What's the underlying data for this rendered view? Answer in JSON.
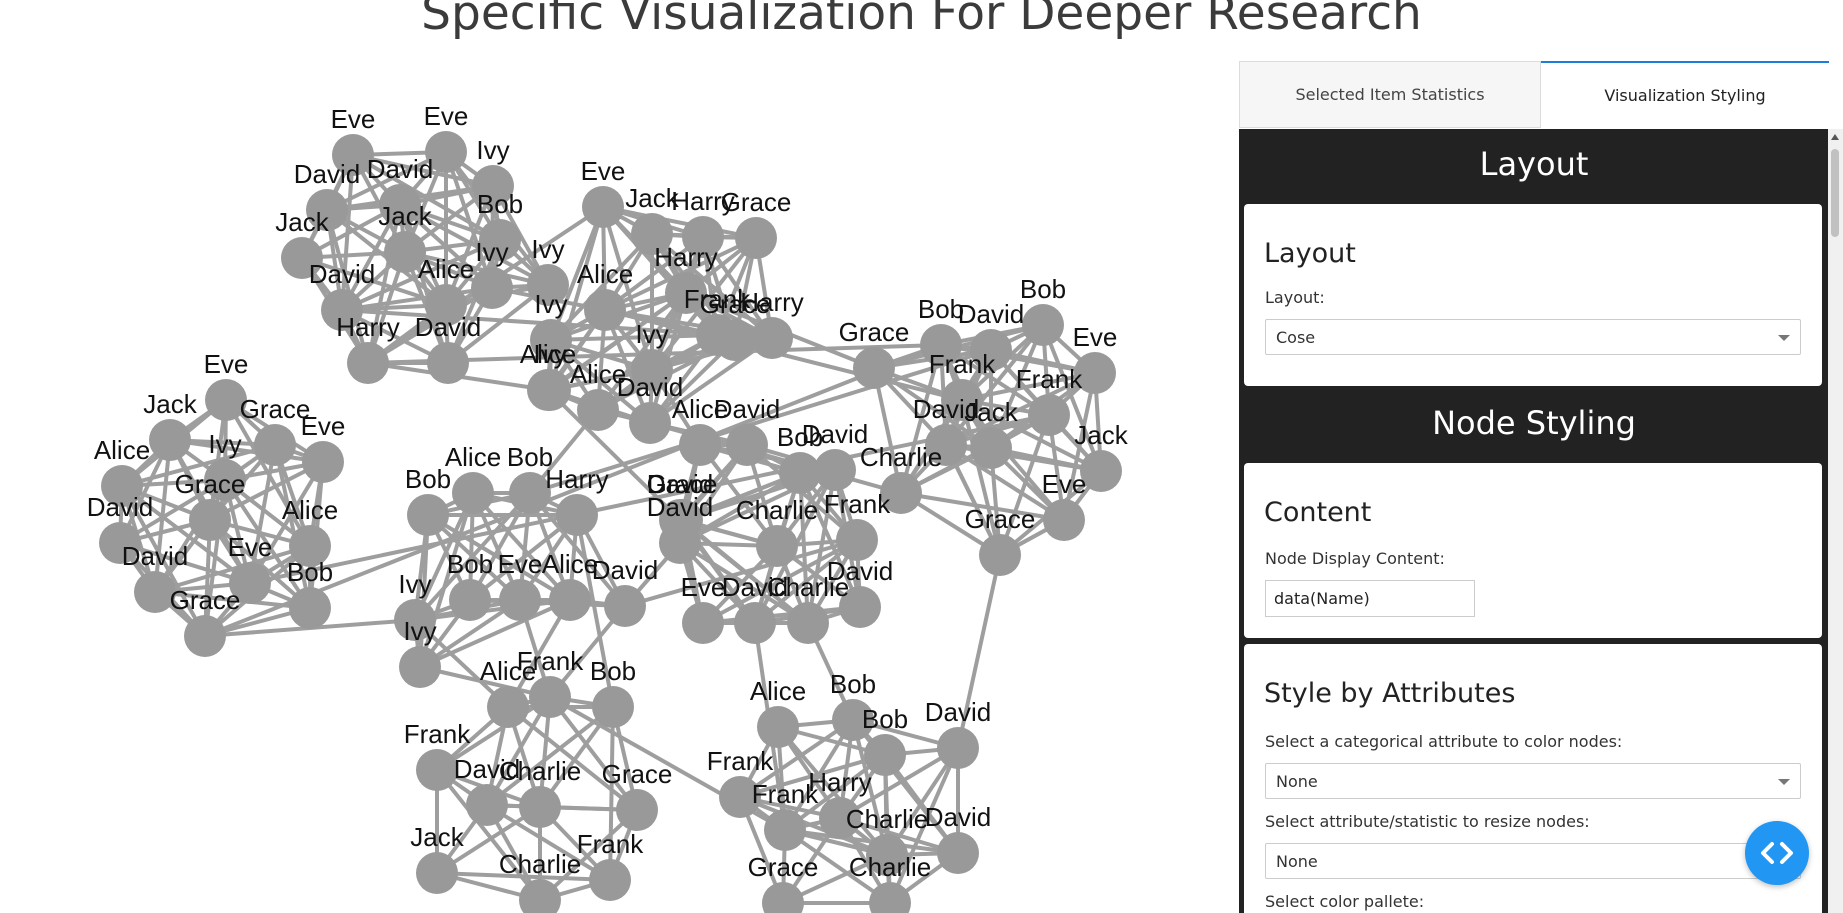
{
  "page": {
    "title": "Specific Visualization For Deeper Research"
  },
  "graph": {
    "node_color": "#999999",
    "edge_color": "#9e9e9e",
    "nodes": [
      {
        "id": "n1",
        "label": "Eve"
      },
      {
        "id": "n2",
        "label": "Eve"
      },
      {
        "id": "n3",
        "label": "Ivy"
      },
      {
        "id": "n4",
        "label": "David"
      },
      {
        "id": "n5",
        "label": "David"
      },
      {
        "id": "n6",
        "label": "Bob"
      },
      {
        "id": "n7",
        "label": "Jack"
      },
      {
        "id": "n8",
        "label": "Jack"
      },
      {
        "id": "n9",
        "label": "Ivy"
      },
      {
        "id": "n10",
        "label": "Ivy"
      },
      {
        "id": "n11",
        "label": "David"
      },
      {
        "id": "n12",
        "label": "Alice"
      },
      {
        "id": "n13",
        "label": "Harry"
      },
      {
        "id": "n14",
        "label": "David"
      },
      {
        "id": "n15",
        "label": "Ivy"
      },
      {
        "id": "n16",
        "label": "Jack"
      },
      {
        "id": "n17",
        "label": "Harry"
      },
      {
        "id": "n18",
        "label": "Grace"
      },
      {
        "id": "n19",
        "label": "Eve"
      },
      {
        "id": "n20",
        "label": "Alice"
      },
      {
        "id": "n21",
        "label": "Harry"
      },
      {
        "id": "n22",
        "label": "Frank"
      },
      {
        "id": "n23",
        "label": "Grace"
      },
      {
        "id": "n24",
        "label": "Harry"
      },
      {
        "id": "n25",
        "label": "Ivy"
      },
      {
        "id": "n26",
        "label": "Ivy"
      },
      {
        "id": "n27",
        "label": "Alice"
      },
      {
        "id": "n28",
        "label": "Alice"
      },
      {
        "id": "n29",
        "label": "David"
      },
      {
        "id": "n30",
        "label": "Bob"
      },
      {
        "id": "n31",
        "label": "David"
      },
      {
        "id": "n32",
        "label": "Bob"
      },
      {
        "id": "n33",
        "label": "Grace"
      },
      {
        "id": "n34",
        "label": "Frank"
      },
      {
        "id": "n35",
        "label": "Eve"
      },
      {
        "id": "n36",
        "label": "Frank"
      },
      {
        "id": "n37",
        "label": "David"
      },
      {
        "id": "n38",
        "label": "Jack"
      },
      {
        "id": "n39",
        "label": "Charlie"
      },
      {
        "id": "n40",
        "label": "Jack"
      },
      {
        "id": "n41",
        "label": "Eve"
      },
      {
        "id": "n42",
        "label": "Grace"
      },
      {
        "id": "n43",
        "label": "Eve"
      },
      {
        "id": "n44",
        "label": "Jack"
      },
      {
        "id": "n45",
        "label": "Grace"
      },
      {
        "id": "n46",
        "label": "Eve"
      },
      {
        "id": "n47",
        "label": "Alice"
      },
      {
        "id": "n48",
        "label": "Ivy"
      },
      {
        "id": "n49",
        "label": "David"
      },
      {
        "id": "n50",
        "label": "Grace"
      },
      {
        "id": "n51",
        "label": "Alice"
      },
      {
        "id": "n52",
        "label": "David"
      },
      {
        "id": "n53",
        "label": "Eve"
      },
      {
        "id": "n54",
        "label": "Bob"
      },
      {
        "id": "n55",
        "label": "Grace"
      },
      {
        "id": "n56",
        "label": "Bob"
      },
      {
        "id": "n57",
        "label": "Alice"
      },
      {
        "id": "n58",
        "label": "Bob"
      },
      {
        "id": "n59",
        "label": "Harry"
      },
      {
        "id": "n60",
        "label": "Ivy"
      },
      {
        "id": "n61",
        "label": "Bob"
      },
      {
        "id": "n62",
        "label": "Eve"
      },
      {
        "id": "n63",
        "label": "Alice"
      },
      {
        "id": "n64",
        "label": "David"
      },
      {
        "id": "n65",
        "label": "Ivy"
      },
      {
        "id": "n66",
        "label": "David"
      },
      {
        "id": "n67",
        "label": "Alice"
      },
      {
        "id": "n68",
        "label": "David"
      },
      {
        "id": "n69",
        "label": "Bob"
      },
      {
        "id": "n70",
        "label": "David"
      },
      {
        "id": "n71",
        "label": "David"
      },
      {
        "id": "n72",
        "label": "Grace"
      },
      {
        "id": "n73",
        "label": "Charlie"
      },
      {
        "id": "n74",
        "label": "Frank"
      },
      {
        "id": "n75",
        "label": "Eve"
      },
      {
        "id": "n76",
        "label": "David"
      },
      {
        "id": "n77",
        "label": "Charlie"
      },
      {
        "id": "n78",
        "label": "David"
      },
      {
        "id": "n79",
        "label": "Alice"
      },
      {
        "id": "n80",
        "label": "Frank"
      },
      {
        "id": "n81",
        "label": "Bob"
      },
      {
        "id": "n82",
        "label": "Frank"
      },
      {
        "id": "n83",
        "label": "David"
      },
      {
        "id": "n84",
        "label": "Charlie"
      },
      {
        "id": "n85",
        "label": "Grace"
      },
      {
        "id": "n86",
        "label": "Jack"
      },
      {
        "id": "n87",
        "label": "Frank"
      },
      {
        "id": "n88",
        "label": "Charlie"
      },
      {
        "id": "n89",
        "label": "Alice"
      },
      {
        "id": "n90",
        "label": "Bob"
      },
      {
        "id": "n91",
        "label": "Bob"
      },
      {
        "id": "n92",
        "label": "David"
      },
      {
        "id": "n93",
        "label": "Frank"
      },
      {
        "id": "n94",
        "label": "Frank"
      },
      {
        "id": "n95",
        "label": "Harry"
      },
      {
        "id": "n96",
        "label": "Charlie"
      },
      {
        "id": "n97",
        "label": "David"
      },
      {
        "id": "n98",
        "label": "Grace"
      },
      {
        "id": "n99",
        "label": "Charlie"
      }
    ],
    "edges": [
      [
        "n19",
        "n13"
      ],
      [
        "n13",
        "n30"
      ],
      [
        "n13",
        "n28"
      ],
      [
        "n19",
        "n26"
      ],
      [
        "n41",
        "n42"
      ],
      [
        "n37",
        "n42"
      ],
      [
        "n42",
        "n92"
      ],
      [
        "n36",
        "n53"
      ],
      [
        "n21",
        "n33"
      ],
      [
        "n30",
        "n55"
      ],
      [
        "n55",
        "n60"
      ],
      [
        "n60",
        "n65"
      ],
      [
        "n65",
        "n80"
      ],
      [
        "n64",
        "n71"
      ],
      [
        "n64",
        "n80"
      ],
      [
        "n80",
        "n94"
      ],
      [
        "n77",
        "n90"
      ],
      [
        "n31",
        "n58"
      ],
      [
        "n27",
        "n58"
      ],
      [
        "n28",
        "n66"
      ],
      [
        "n63",
        "n79"
      ],
      [
        "n29",
        "n39"
      ],
      [
        "n20",
        "n34"
      ],
      [
        "n15",
        "n28"
      ],
      [
        "n62",
        "n80"
      ],
      [
        "n60",
        "n79"
      ],
      [
        "n57",
        "n65"
      ],
      [
        "n64",
        "n74"
      ],
      [
        "n76",
        "n94"
      ],
      [
        "n29",
        "n68"
      ],
      [
        "n25",
        "n67"
      ],
      [
        "n11",
        "n24"
      ],
      [
        "n1",
        "n4"
      ],
      [
        "n9",
        "n20"
      ],
      [
        "n59",
        "n81"
      ]
    ]
  },
  "panel": {
    "tabs": [
      {
        "label": "Selected Item Statistics",
        "active": false
      },
      {
        "label": "Visualization Styling",
        "active": true
      }
    ],
    "layout_section": {
      "header": "Layout",
      "card_title": "Layout",
      "layout_label": "Layout:",
      "layout_value": "Cose"
    },
    "node_styling": {
      "header": "Node Styling",
      "content_card_title": "Content",
      "display_content_label": "Node Display Content:",
      "display_content_value": "data(Name)",
      "style_card_title": "Style by Attributes",
      "color_attr_label": "Select a categorical attribute to color nodes:",
      "color_attr_value": "None",
      "resize_label": "Select attribute/statistic to resize nodes:",
      "resize_value": "None",
      "palette_label": "Select color pallete:"
    }
  },
  "icons": {
    "fab": "code-icon"
  }
}
